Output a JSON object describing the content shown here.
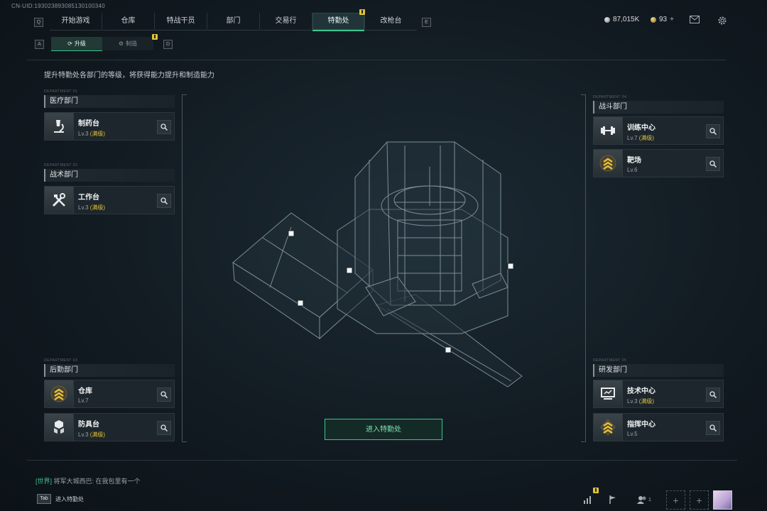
{
  "uid": "CN-UID:1930238930851301003​40",
  "nav": {
    "left_key": "Q",
    "right_key": "E",
    "tabs": [
      {
        "label": "开始游戏",
        "active": false
      },
      {
        "label": "仓库",
        "active": false
      },
      {
        "label": "特战干员",
        "active": false
      },
      {
        "label": "部门",
        "active": false
      },
      {
        "label": "交易行",
        "active": false
      },
      {
        "label": "特勤处",
        "active": true,
        "badge": true
      },
      {
        "label": "改枪台",
        "active": false
      }
    ]
  },
  "currency": {
    "coins": "87,015K",
    "gold": "93"
  },
  "subnav": {
    "left_key": "A",
    "right_key": "D",
    "tabs": [
      {
        "label": "升级",
        "active": true
      },
      {
        "label": "制造",
        "active": false,
        "badge": true
      }
    ]
  },
  "description": "提升特勤处各部门的等级，将获得能力提升和制造能力",
  "departments": {
    "medical": {
      "title": "医疗部门",
      "items": [
        {
          "name": "制药台",
          "level": "Lv.3",
          "max": "(满级)",
          "icon": "microscope-icon"
        }
      ]
    },
    "tactical": {
      "title": "战术部门",
      "items": [
        {
          "name": "工作台",
          "level": "Lv.3",
          "max": "(满级)",
          "icon": "tools-icon"
        }
      ]
    },
    "logistics": {
      "title": "后勤部门",
      "items": [
        {
          "name": "仓库",
          "level": "Lv.7",
          "max": "",
          "icon": "chevron-rank-icon"
        },
        {
          "name": "防具台",
          "level": "Lv.3",
          "max": "(满级)",
          "icon": "cubes-icon"
        }
      ]
    },
    "combat": {
      "title": "战斗部门",
      "items": [
        {
          "name": "训练中心",
          "level": "Lv.7",
          "max": "(满级)",
          "icon": "dumbbell-icon"
        },
        {
          "name": "靶场",
          "level": "Lv.6",
          "max": "",
          "icon": "chevron-rank-icon"
        }
      ]
    },
    "research": {
      "title": "研发部门",
      "items": [
        {
          "name": "技术中心",
          "level": "Lv.3",
          "max": "(满级)",
          "icon": "monitor-icon"
        },
        {
          "name": "指挥中心",
          "level": "Lv.5",
          "max": "",
          "icon": "chevron-rank-icon"
        }
      ]
    }
  },
  "enter_button": "进入特勤处",
  "chat": {
    "channel": "[世界]",
    "text": "将军大城西巴: 在我包里有一个"
  },
  "tab_hint": {
    "key": "Tab",
    "label": "进入特勤处"
  },
  "bottom_bar": {
    "friends_count": "1"
  },
  "colors": {
    "accent": "#39c58f",
    "gold": "#e2c13b",
    "background": "#121b22"
  }
}
